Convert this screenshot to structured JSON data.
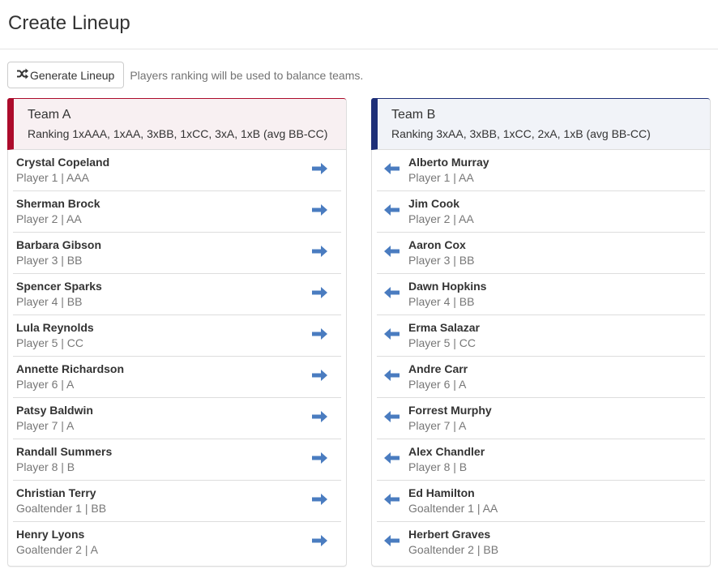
{
  "page": {
    "title": "Create Lineup"
  },
  "toolbar": {
    "generate_label": "Generate Lineup",
    "generate_icon": "shuffle-icon",
    "help_text": "Players ranking will be used to balance teams."
  },
  "colors": {
    "team_a_accent": "#ac0b2b",
    "team_b_accent": "#1e2f78",
    "arrow": "#4a7cc0"
  },
  "teams": [
    {
      "name": "Team A",
      "ranking": "Ranking 1xAAA, 1xAA, 3xBB, 1xCC, 3xA, 1xB (avg BB-CC)",
      "move_icon": "arrow-right-icon",
      "players": [
        {
          "name": "Crystal Copeland",
          "meta": "Player 1 | AAA"
        },
        {
          "name": "Sherman Brock",
          "meta": "Player 2 | AA"
        },
        {
          "name": "Barbara Gibson",
          "meta": "Player 3 | BB"
        },
        {
          "name": "Spencer Sparks",
          "meta": "Player 4 | BB"
        },
        {
          "name": "Lula Reynolds",
          "meta": "Player 5 | CC"
        },
        {
          "name": "Annette Richardson",
          "meta": "Player 6 | A"
        },
        {
          "name": "Patsy Baldwin",
          "meta": "Player 7 | A"
        },
        {
          "name": "Randall Summers",
          "meta": "Player 8 | B"
        },
        {
          "name": "Christian Terry",
          "meta": "Goaltender 1 | BB"
        },
        {
          "name": "Henry Lyons",
          "meta": "Goaltender 2 | A"
        }
      ]
    },
    {
      "name": "Team B",
      "ranking": "Ranking 3xAA, 3xBB, 1xCC, 2xA, 1xB (avg BB-CC)",
      "move_icon": "arrow-left-icon",
      "players": [
        {
          "name": "Alberto Murray",
          "meta": "Player 1 | AA"
        },
        {
          "name": "Jim Cook",
          "meta": "Player 2 | AA"
        },
        {
          "name": "Aaron Cox",
          "meta": "Player 3 | BB"
        },
        {
          "name": "Dawn Hopkins",
          "meta": "Player 4 | BB"
        },
        {
          "name": "Erma Salazar",
          "meta": "Player 5 | CC"
        },
        {
          "name": "Andre Carr",
          "meta": "Player 6 | A"
        },
        {
          "name": "Forrest Murphy",
          "meta": "Player 7 | A"
        },
        {
          "name": "Alex Chandler",
          "meta": "Player 8 | B"
        },
        {
          "name": "Ed Hamilton",
          "meta": "Goaltender 1 | AA"
        },
        {
          "name": "Herbert Graves",
          "meta": "Goaltender 2 | BB"
        }
      ]
    }
  ]
}
